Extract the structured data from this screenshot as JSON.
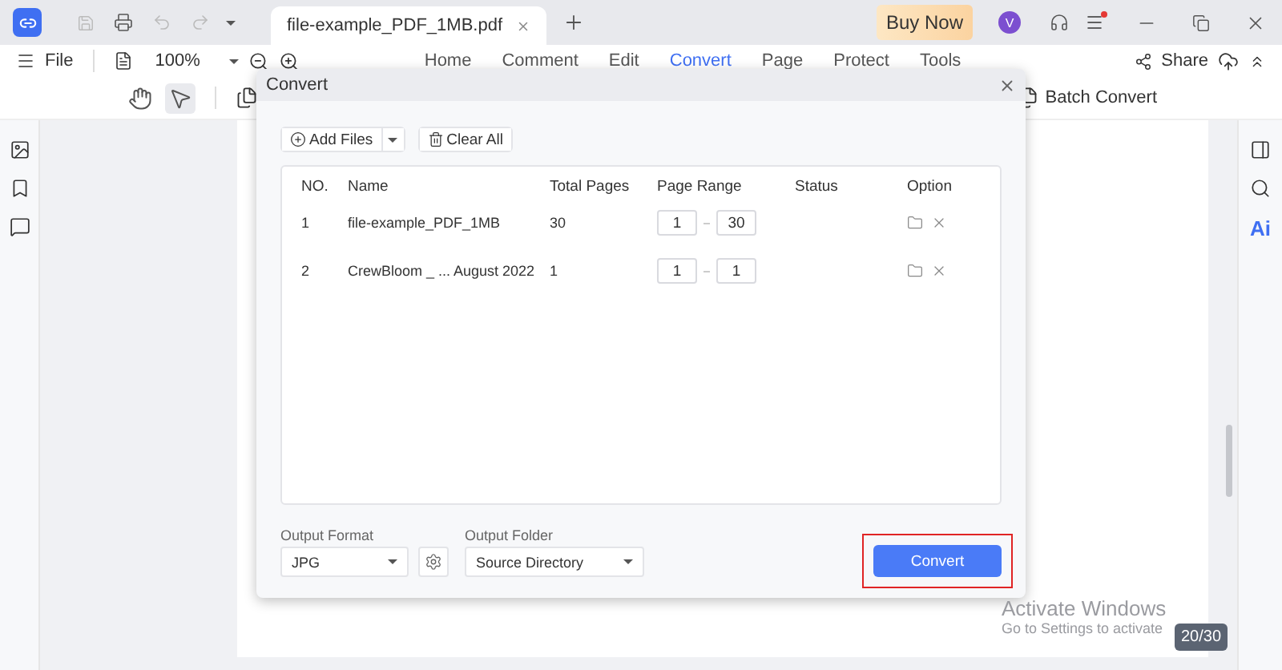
{
  "app_tab": {
    "title": "file-example_PDF_1MB.pdf"
  },
  "buy_now": "Buy Now",
  "avatar": "V",
  "menu": {
    "file": "File",
    "zoom": "100%",
    "share": "Share",
    "tabs": [
      {
        "label": "Home",
        "selected": false
      },
      {
        "label": "Comment",
        "selected": false
      },
      {
        "label": "Edit",
        "selected": false
      },
      {
        "label": "Convert",
        "selected": true
      },
      {
        "label": "Page",
        "selected": false
      },
      {
        "label": "Protect",
        "selected": false
      },
      {
        "label": "Tools",
        "selected": false
      }
    ]
  },
  "batch_convert": "Batch Convert",
  "dialog": {
    "title": "Convert",
    "add_files": "Add Files",
    "clear_all": "Clear All",
    "columns": [
      "NO.",
      "Name",
      "Total Pages",
      "Page Range",
      "Status",
      "Option"
    ],
    "rows": [
      {
        "no": "1",
        "name": "file-example_PDF_1MB",
        "total_pages": "30",
        "range_from": "1",
        "range_to": "30"
      },
      {
        "no": "2",
        "name": "CrewBloom _ ... August 2022",
        "total_pages": "1",
        "range_from": "1",
        "range_to": "1"
      }
    ],
    "output_format": {
      "label": "Output Format",
      "value": "JPG"
    },
    "output_folder": {
      "label": "Output Folder",
      "value": "Source Directory"
    },
    "convert": {
      "label": "Convert",
      "highlighted": true
    }
  },
  "ai_label": "Ai",
  "page_counter": "20/30",
  "windows_notice": {
    "title": "Activate Windows",
    "text": "Go to Settings to activate"
  }
}
